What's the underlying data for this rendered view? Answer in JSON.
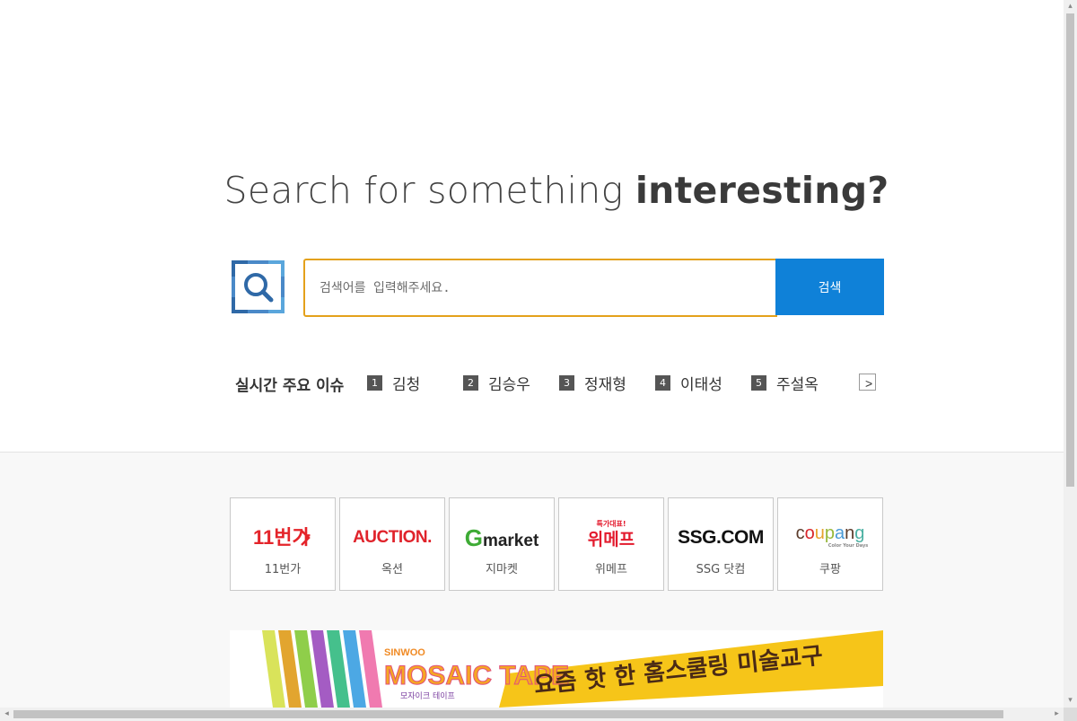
{
  "headline": {
    "light": "Search for something ",
    "bold": "interesting?"
  },
  "search": {
    "placeholder": "검색어를 입력해주세요.",
    "button_label": "검색"
  },
  "trending": {
    "title": "실시간 주요 이슈",
    "items": [
      {
        "rank": "1",
        "label": "김청"
      },
      {
        "rank": "2",
        "label": "김승우"
      },
      {
        "rank": "3",
        "label": "정재형"
      },
      {
        "rank": "4",
        "label": "이태성"
      },
      {
        "rank": "5",
        "label": "주설옥"
      }
    ],
    "next_label": ">"
  },
  "shops": [
    {
      "logo_text": "11번가",
      "name": "11번가",
      "color": "#e4242a"
    },
    {
      "logo_text": "AUCTION.",
      "name": "옥션",
      "color": "#e0232b"
    },
    {
      "logo_text": "Gmarket",
      "name": "지마켓",
      "color": "#222222"
    },
    {
      "logo_text": "위메프",
      "name": "위메프",
      "color": "#e31a2d",
      "tagline": "특가대표!"
    },
    {
      "logo_text": "SSG.COM",
      "name": "SSG 닷컴",
      "color": "#111111"
    },
    {
      "logo_text": "coupang",
      "name": "쿠팡",
      "color": "#5b3b2a",
      "tagline": "Color Your Days"
    }
  ],
  "banner": {
    "brand": "SINWOO",
    "product": "MOSAIC TAPE",
    "subtitle": "모자이크 테이프",
    "slogan": "요즘 핫 한 홈스쿨링 미술교구"
  },
  "colors": {
    "accent_border": "#e4a11b",
    "button_blue": "#0f81d8",
    "logo_blue": "#2f69a7"
  }
}
